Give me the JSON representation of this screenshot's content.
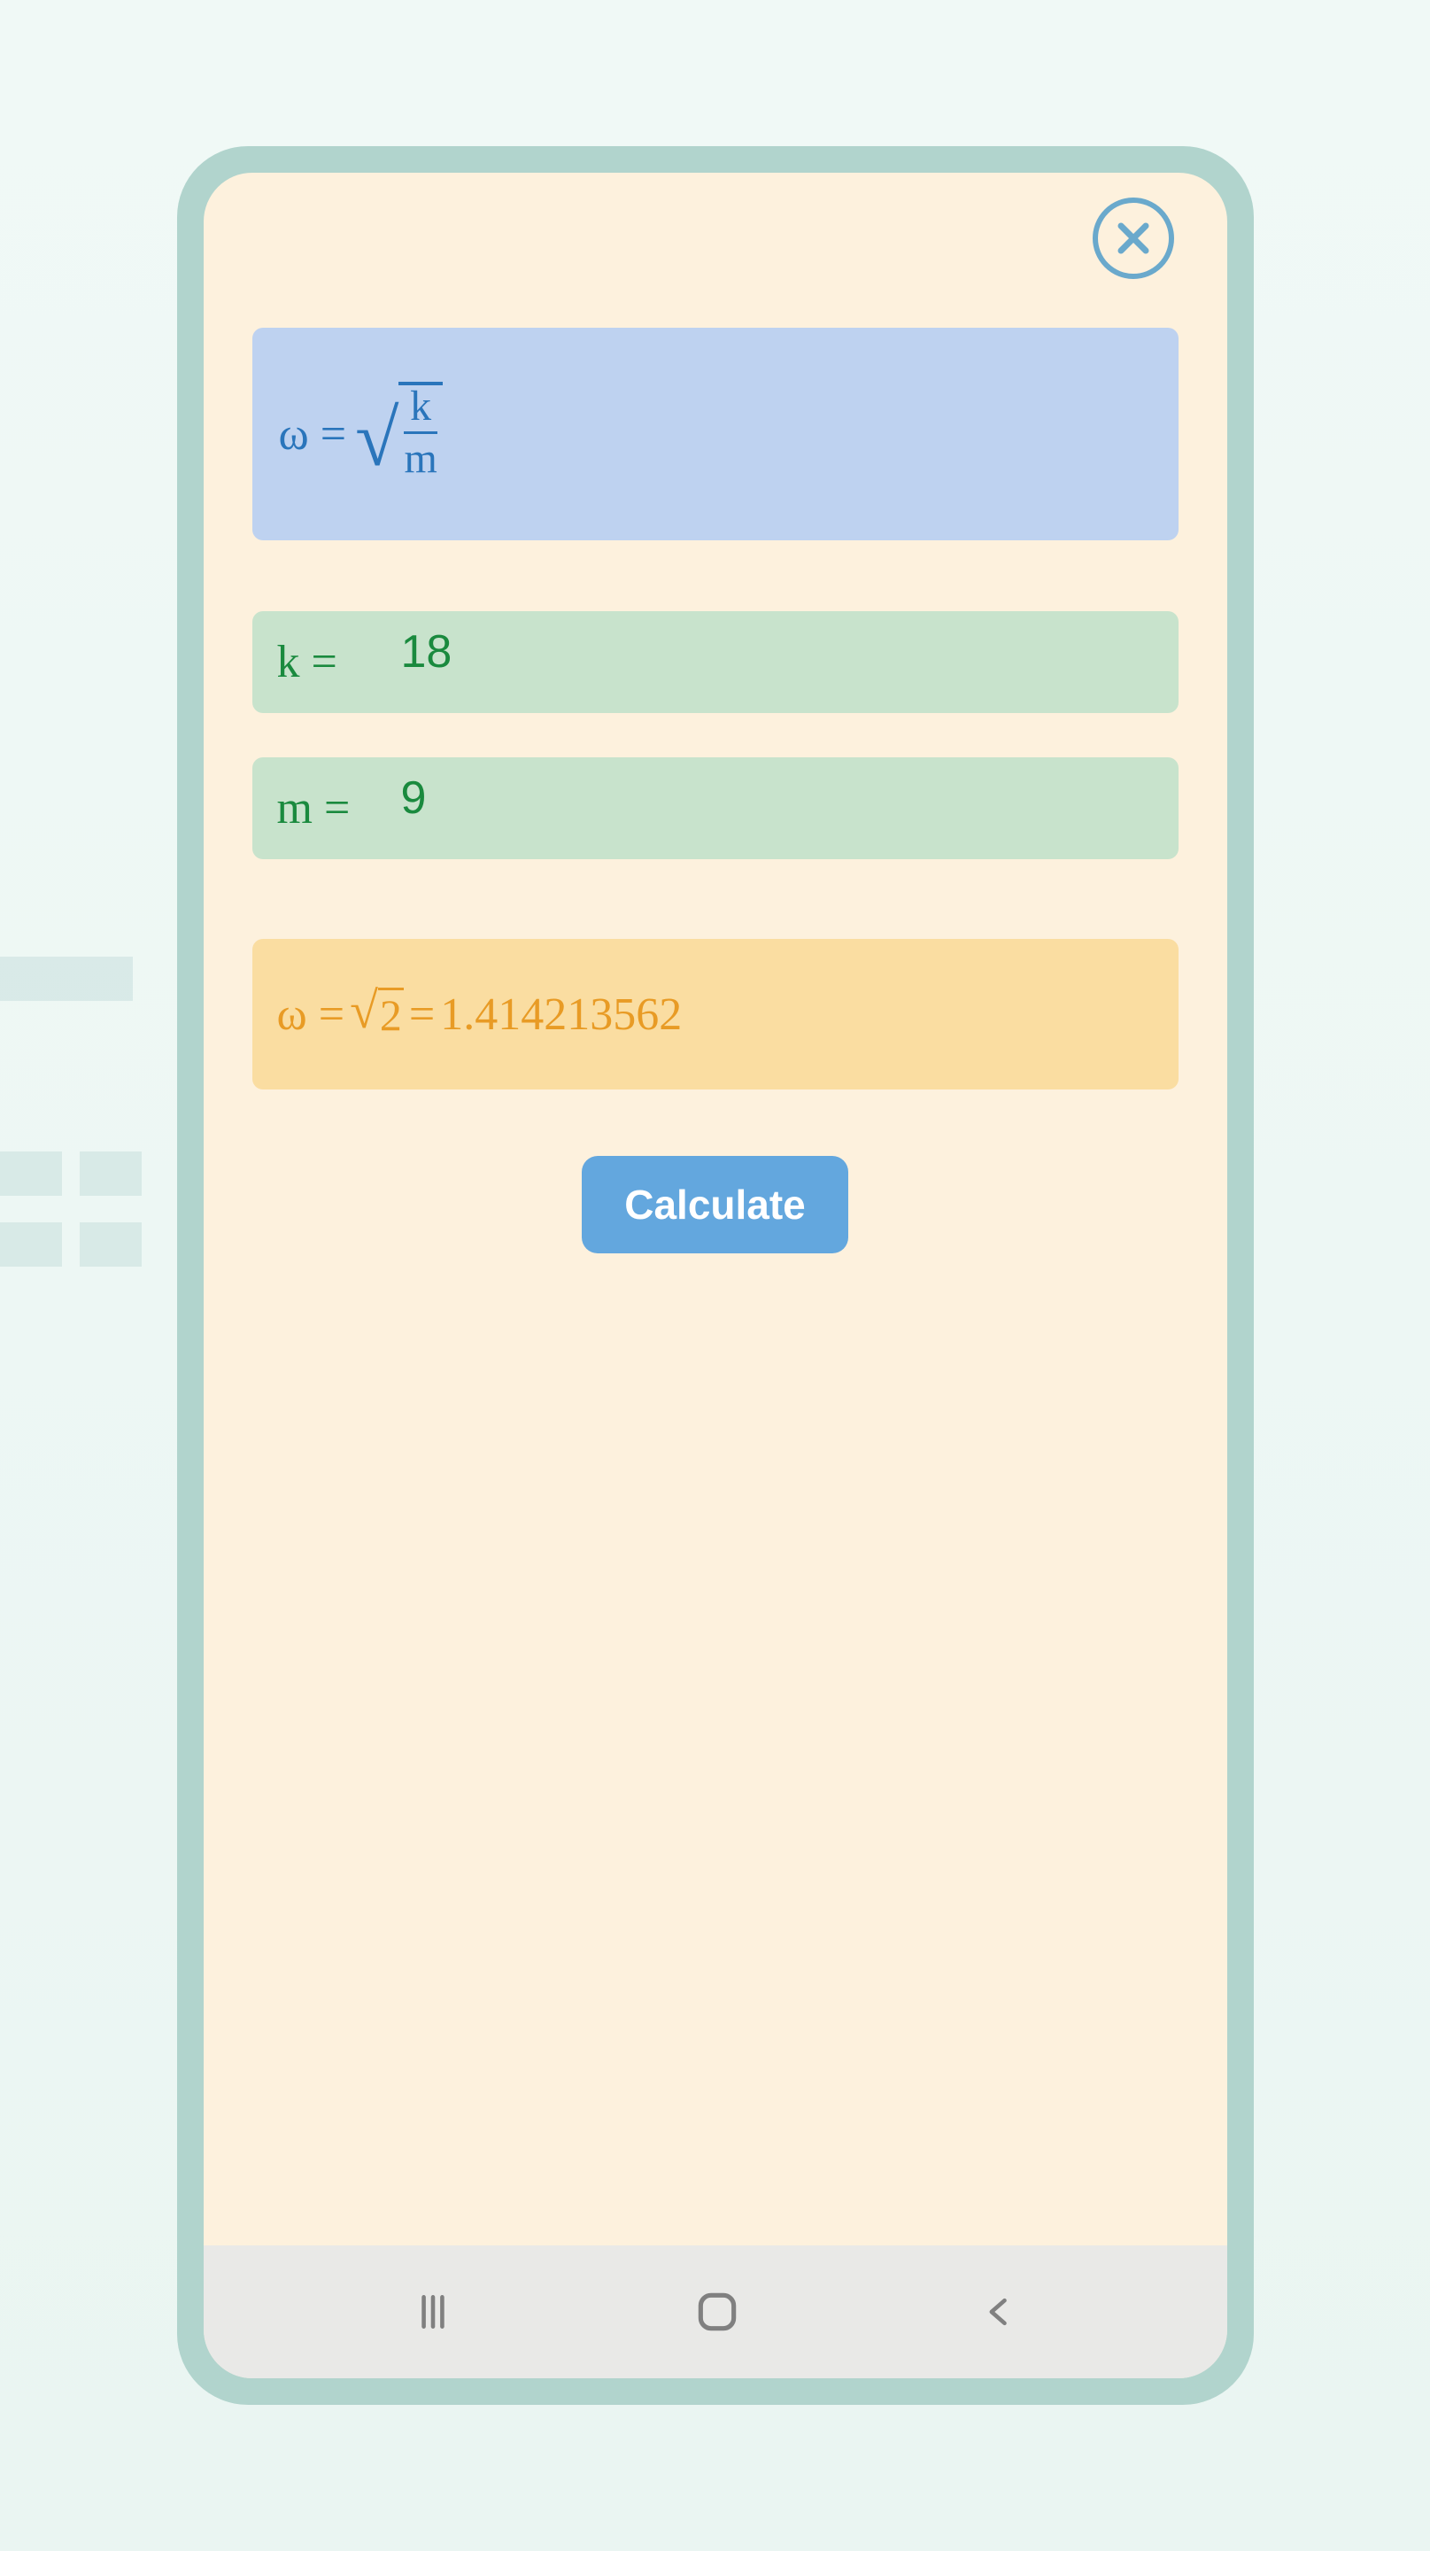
{
  "formula": {
    "lhs": "ω =",
    "numerator": "k",
    "denominator": "m"
  },
  "inputs": {
    "k_label": "k =",
    "k_value": "18",
    "m_label": "m =",
    "m_value": "9"
  },
  "result": {
    "lhs": "ω =",
    "sqrt_val": "2",
    "eq": "=",
    "decimal": "1.414213562"
  },
  "buttons": {
    "calculate": "Calculate"
  }
}
